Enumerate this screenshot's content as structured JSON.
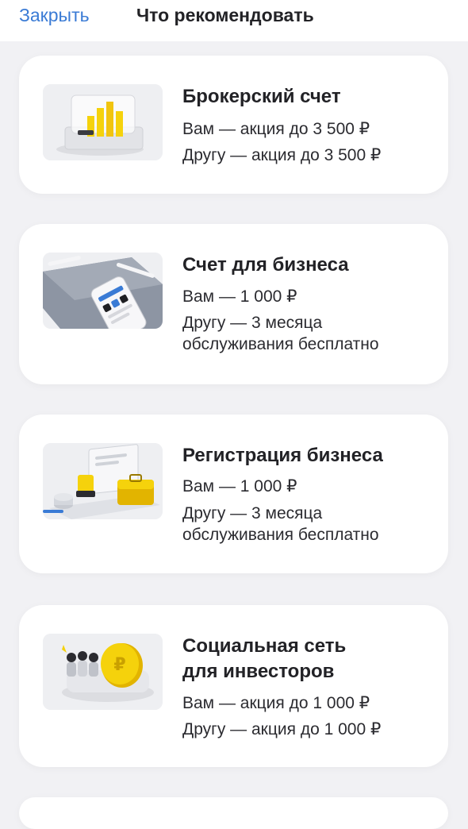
{
  "header": {
    "close_label": "Закрыть",
    "title": "Что рекомендовать"
  },
  "cards": [
    {
      "title": "Брокерский счет",
      "you": "Вам — акция до 3 500 ₽",
      "friend": "Другу — акция до 3 500 ₽",
      "illustration": "stock-chart-stand-illustration"
    },
    {
      "title": "Счет для бизнеса",
      "you": "Вам — 1 000 ₽",
      "friend": "Другу — 3 месяца\nобслуживания бесплатно",
      "illustration": "tablet-phone-pen-illustration"
    },
    {
      "title": "Регистрация бизнеса",
      "you": "Вам — 1 000 ₽",
      "friend": "Другу — 3 месяца\nобслуживания бесплатно",
      "illustration": "documents-stamp-briefcase-illustration"
    },
    {
      "title": "Социальная сеть\nдля инвесторов",
      "you": "Вам — акция до 1 000 ₽",
      "friend": "Другу — акция до 1 000 ₽",
      "illustration": "people-coin-illustration"
    }
  ],
  "colors": {
    "accent_link": "#3a7bd5",
    "background": "#f1f1f4",
    "card": "#ffffff",
    "brand_yellow": "#f5d20c"
  }
}
